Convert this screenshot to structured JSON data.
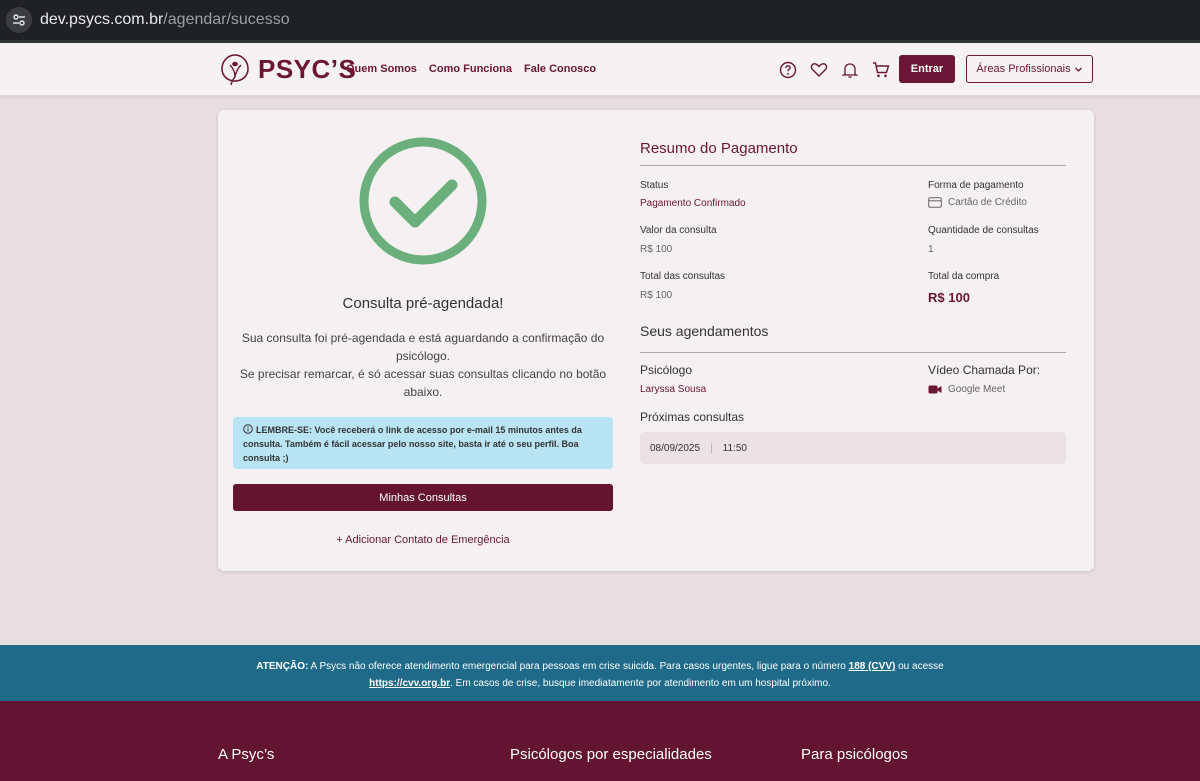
{
  "browser": {
    "url_host": "dev.psycs.com.br",
    "url_path": "/agendar/sucesso"
  },
  "header": {
    "logo_text": "PSYC’S",
    "nav": [
      "Quem Somos",
      "Como Funciona",
      "Fale Conosco"
    ],
    "icons": [
      "help-icon",
      "heart-icon",
      "bell-icon",
      "cart-icon"
    ],
    "login_label": "Entrar",
    "areas_label": "Áreas Profissionais"
  },
  "success": {
    "title": "Consulta pré-agendada!",
    "desc_line1": "Sua consulta foi pré-agendada e está aguardando a confirmação do psicólogo.",
    "desc_line2": "Se precisar remarcar, é só acessar suas consultas clicando no botão abaixo.",
    "reminder": "LEMBRE-SE: Você receberá o link de acesso por e-mail 15 minutos antes da consulta. Também é fácil acessar pelo nosso site, basta ir até o seu perfil. Boa consulta ;)",
    "my_appointments_button": "Minhas Consultas",
    "emergency_link": "+ Adicionar Contato de Emergência"
  },
  "summary": {
    "title": "Resumo do Pagamento",
    "status_label": "Status",
    "status_value": "Pagamento Confirmado",
    "payment_method_label": "Forma de pagamento",
    "payment_method_value": "Cartão de Crédito",
    "price_label": "Valor da consulta",
    "price_value": "R$ 100",
    "quantity_label": "Quantidade de consultas",
    "quantity_value": "1",
    "total_consults_label": "Total das consultas",
    "total_consults_value": "R$ 100",
    "total_purchase_label": "Total da compra",
    "total_purchase_value": "R$ 100"
  },
  "appointments": {
    "title": "Seus agendamentos",
    "psychologist_label": "Psicólogo",
    "psychologist_value": "Laryssa Sousa",
    "video_label": "Vídeo Chamada Por:",
    "video_value": "Google Meet",
    "next_label": "Próximas consultas",
    "next_date": "08/09/2025",
    "next_time": "11:50"
  },
  "attention": {
    "label": "ATENÇÃO:",
    "text1": " A Psycs não oferece atendimento emergencial para pessoas em crise suicida. Para casos urgentes, ligue para o número ",
    "phone": "188 (CVV)",
    "text2": " ou acesse",
    "link": "https://cvv.org.br",
    "text3": ". Em casos de crise, busque imediatamente por atendimento em um hospital próximo."
  },
  "footer": {
    "col1": "A Psyc’s",
    "col2": "Psicólogos por especialidades",
    "col3": "Para psicólogos"
  },
  "colors": {
    "brand": "#6a1634",
    "success_green": "#6aaf7c",
    "alert_bg": "#b9e4f3",
    "attention_bg": "#1e6a88"
  }
}
